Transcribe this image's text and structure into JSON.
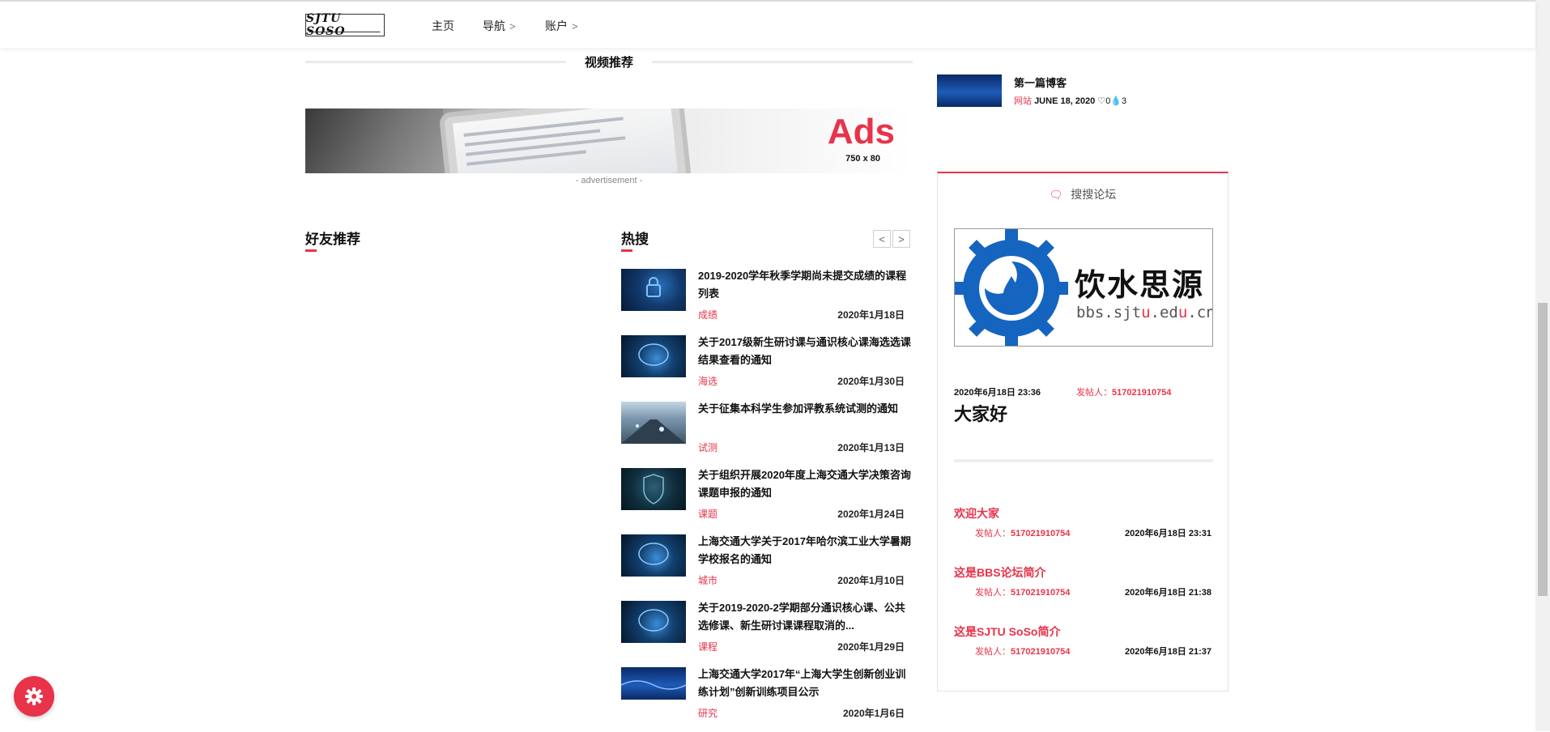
{
  "header": {
    "logo_text": "SJTU SOSO",
    "nav": [
      {
        "label": "主页",
        "has_submenu": false
      },
      {
        "label": "导航",
        "has_submenu": true
      },
      {
        "label": "账户",
        "has_submenu": true
      }
    ]
  },
  "video_section": {
    "title": "视频推荐"
  },
  "ad": {
    "text": "Ads",
    "size": "750 x 80",
    "caption": "- advertisement -"
  },
  "friends": {
    "heading": "好友推荐"
  },
  "hot": {
    "heading": "热搜",
    "items": [
      {
        "title": "2019-2020学年秋季学期尚未提交成绩的课程列表",
        "tag": "成绩",
        "date": "2020年1月18日",
        "thumb": "lock-icon"
      },
      {
        "title": "关于2017级新生研讨课与通识核心课海选选课结果查看的通知",
        "tag": "海选",
        "date": "2020年1月30日",
        "thumb": "brain-icon"
      },
      {
        "title": "关于征集本科学生参加评教系统试测的通知",
        "tag": "试测",
        "date": "2020年1月13日",
        "thumb": "city-icon"
      },
      {
        "title": "关于组织开展2020年度上海交通大学决策咨询课题申报的通知",
        "tag": "课题",
        "date": "2020年1月24日",
        "thumb": "shield-icon"
      },
      {
        "title": "上海交通大学关于2017年哈尔滨工业大学暑期学校报名的通知",
        "tag": "城市",
        "date": "2020年1月10日",
        "thumb": "brain-icon"
      },
      {
        "title": "关于2019-2020-2学期部分通识核心课、公共选修课、新生研讨课课程取消的...",
        "tag": "课程",
        "date": "2020年1月29日",
        "thumb": "brain-icon"
      },
      {
        "title": "上海交通大学2017年“上海大学生创新创业训练计划”创新训练项目公示",
        "tag": "研究",
        "date": "2020年1月6日",
        "thumb": "wave-icon"
      }
    ]
  },
  "blog": {
    "title": "第一篇博客",
    "tag": "网站",
    "date": "JUNE 18, 2020",
    "likes": "0",
    "comments": "3"
  },
  "forum": {
    "header": "搜搜论坛",
    "logo": {
      "name": "饮水思源",
      "url_pre": "bbs.sjt",
      "url_hl1": "u",
      "url_mid": ".ed",
      "url_hl2": "u",
      "url_post": ".cn"
    },
    "post": {
      "date": "2020年6月18日 23:36",
      "author_label": "发帖人：",
      "author": "517021910754",
      "title": "大家好"
    },
    "replies": [
      {
        "title": "欢迎大家",
        "author_label": "发帖人：",
        "author": "517021910754",
        "date": "2020年6月18日 23:31"
      },
      {
        "title": "这是BBS论坛简介",
        "author_label": "发帖人：",
        "author": "517021910754",
        "date": "2020年6月18日 21:38"
      },
      {
        "title": "这是SJTU SoSo简介",
        "author_label": "发帖人：",
        "author": "517021910754",
        "date": "2020年6月18日 21:37"
      }
    ]
  },
  "colors": {
    "accent": "#e8334a",
    "text": "#111111",
    "muted": "#888888"
  }
}
